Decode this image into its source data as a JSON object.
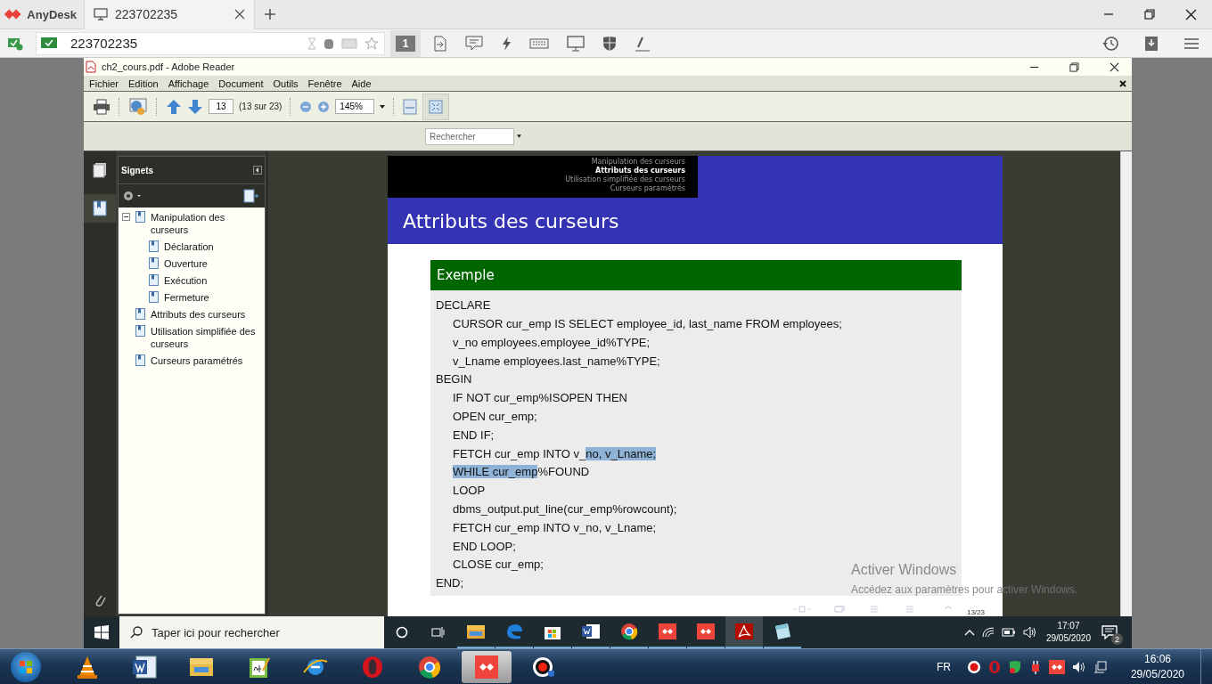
{
  "anydesk": {
    "app_name": "AnyDesk",
    "tab": {
      "label": "223702235"
    },
    "address": "223702235",
    "session_number": "1"
  },
  "reader": {
    "title": "ch2_cours.pdf - Adobe Reader",
    "menu": [
      "Fichier",
      "Edition",
      "Affichage",
      "Document",
      "Outils",
      "Fenêtre",
      "Aide"
    ],
    "page_field": "13",
    "page_count": "(13 sur 23)",
    "zoom": "145%",
    "search": {
      "placeholder": "Rechercher"
    }
  },
  "bookmarks": {
    "title": "Signets",
    "items": [
      {
        "label": "Manipulation des curseurs",
        "expanded": true,
        "children": [
          {
            "label": "Déclaration"
          },
          {
            "label": "Ouverture"
          },
          {
            "label": "Exécution"
          },
          {
            "label": "Fermeture"
          }
        ]
      },
      {
        "label": "Attributs des curseurs"
      },
      {
        "label": "Utilisation simplifiée des curseurs"
      },
      {
        "label": "Curseurs paramétrés"
      }
    ]
  },
  "slide": {
    "nav": [
      {
        "label": "Manipulation des curseurs",
        "selected": false
      },
      {
        "label": "Attributs des curseurs",
        "selected": true
      },
      {
        "label": "Utilisation simplifiée des curseurs",
        "selected": false
      },
      {
        "label": "Curseurs paramétrés",
        "selected": false
      }
    ],
    "title": "Attributs des curseurs",
    "block_title": "Exemple",
    "code": [
      {
        "text": "DECLARE",
        "indented": false
      },
      {
        "text": "CURSOR cur_emp IS SELECT employee_id, last_name FROM employees;",
        "indented": true
      },
      {
        "text": "v_no employees.employee_id%TYPE;",
        "indented": true
      },
      {
        "text": "v_Lname employees.last_name%TYPE;",
        "indented": true
      },
      {
        "text": "BEGIN",
        "indented": false
      },
      {
        "text": "IF NOT cur_emp%ISOPEN THEN",
        "indented": true
      },
      {
        "text": "OPEN cur_emp;",
        "indented": true
      },
      {
        "text": "END IF;",
        "indented": true
      },
      {
        "indented": true,
        "parts": [
          {
            "text": "FETCH cur_emp INTO v_",
            "selected": false
          },
          {
            "text": "no, v_Lname;",
            "selected": true
          }
        ]
      },
      {
        "indented": true,
        "parts": [
          {
            "text": "WHILE cur_emp",
            "selected": true
          },
          {
            "text": "%FOUND",
            "selected": false
          }
        ]
      },
      {
        "text": "LOOP",
        "indented": true
      },
      {
        "text": "dbms_output.put_line(cur_emp%rowcount);",
        "indented": true
      },
      {
        "text": "FETCH cur_emp INTO v_no, v_Lname;",
        "indented": true
      },
      {
        "text": "END LOOP;",
        "indented": true
      },
      {
        "text": "CLOSE cur_emp;",
        "indented": true
      },
      {
        "text": "END;",
        "indented": false
      }
    ],
    "page_label": "13/23"
  },
  "activation": {
    "title": "Activer Windows",
    "message": "Accédez aux paramètres pour activer Windows."
  },
  "remote_taskbar": {
    "search": {
      "placeholder": "Taper ici pour rechercher"
    },
    "apps": [
      {
        "kind": "folder",
        "selected": false
      },
      {
        "kind": "edge",
        "selected": false
      },
      {
        "kind": "store",
        "selected": false
      },
      {
        "kind": "word",
        "selected": false
      },
      {
        "kind": "chrome",
        "selected": false
      },
      {
        "kind": "anydesk",
        "selected": false
      },
      {
        "kind": "anydesk",
        "selected": false
      },
      {
        "kind": "acrobat",
        "selected": true
      },
      {
        "kind": "notes",
        "selected": false
      }
    ],
    "time": "17:07",
    "date": "29/05/2020",
    "notifications": "2"
  },
  "taskbar": {
    "apps": [
      {
        "kind": "vlc",
        "selected": false
      },
      {
        "kind": "word",
        "selected": false
      },
      {
        "kind": "folder",
        "selected": false
      },
      {
        "kind": "notes",
        "selected": false
      },
      {
        "kind": "edge",
        "selected": false
      },
      {
        "kind": "opera",
        "selected": false
      },
      {
        "kind": "chrome",
        "selected": false
      },
      {
        "kind": "anydesk",
        "selected": true
      },
      {
        "kind": "record",
        "selected": false
      }
    ],
    "language": "FR",
    "time": "16:06",
    "date": "29/05/2020"
  }
}
